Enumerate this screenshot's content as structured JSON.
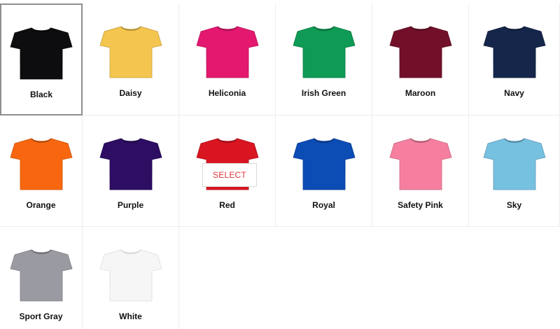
{
  "colors": [
    {
      "name": "Black",
      "hex": "#0d0d0f"
    },
    {
      "name": "Daisy",
      "hex": "#f4c64f"
    },
    {
      "name": "Heliconia",
      "hex": "#e4186f"
    },
    {
      "name": "Irish Green",
      "hex": "#0f9a55"
    },
    {
      "name": "Maroon",
      "hex": "#72102a"
    },
    {
      "name": "Navy",
      "hex": "#15264a"
    },
    {
      "name": "Orange",
      "hex": "#f8670f"
    },
    {
      "name": "Purple",
      "hex": "#2d0e63"
    },
    {
      "name": "Red",
      "hex": "#d91522"
    },
    {
      "name": "Royal",
      "hex": "#0c4cb5"
    },
    {
      "name": "Safety Pink",
      "hex": "#f67fa0"
    },
    {
      "name": "Sky",
      "hex": "#76c0e0"
    },
    {
      "name": "Sport Gray",
      "hex": "#9a9aa2"
    },
    {
      "name": "White",
      "hex": "#f6f6f6"
    }
  ],
  "selected": "Black",
  "hovered": "Red",
  "select_label": "SELECT",
  "select_text_color": "#e0363a",
  "selected_border_color": "#8e8e8e"
}
